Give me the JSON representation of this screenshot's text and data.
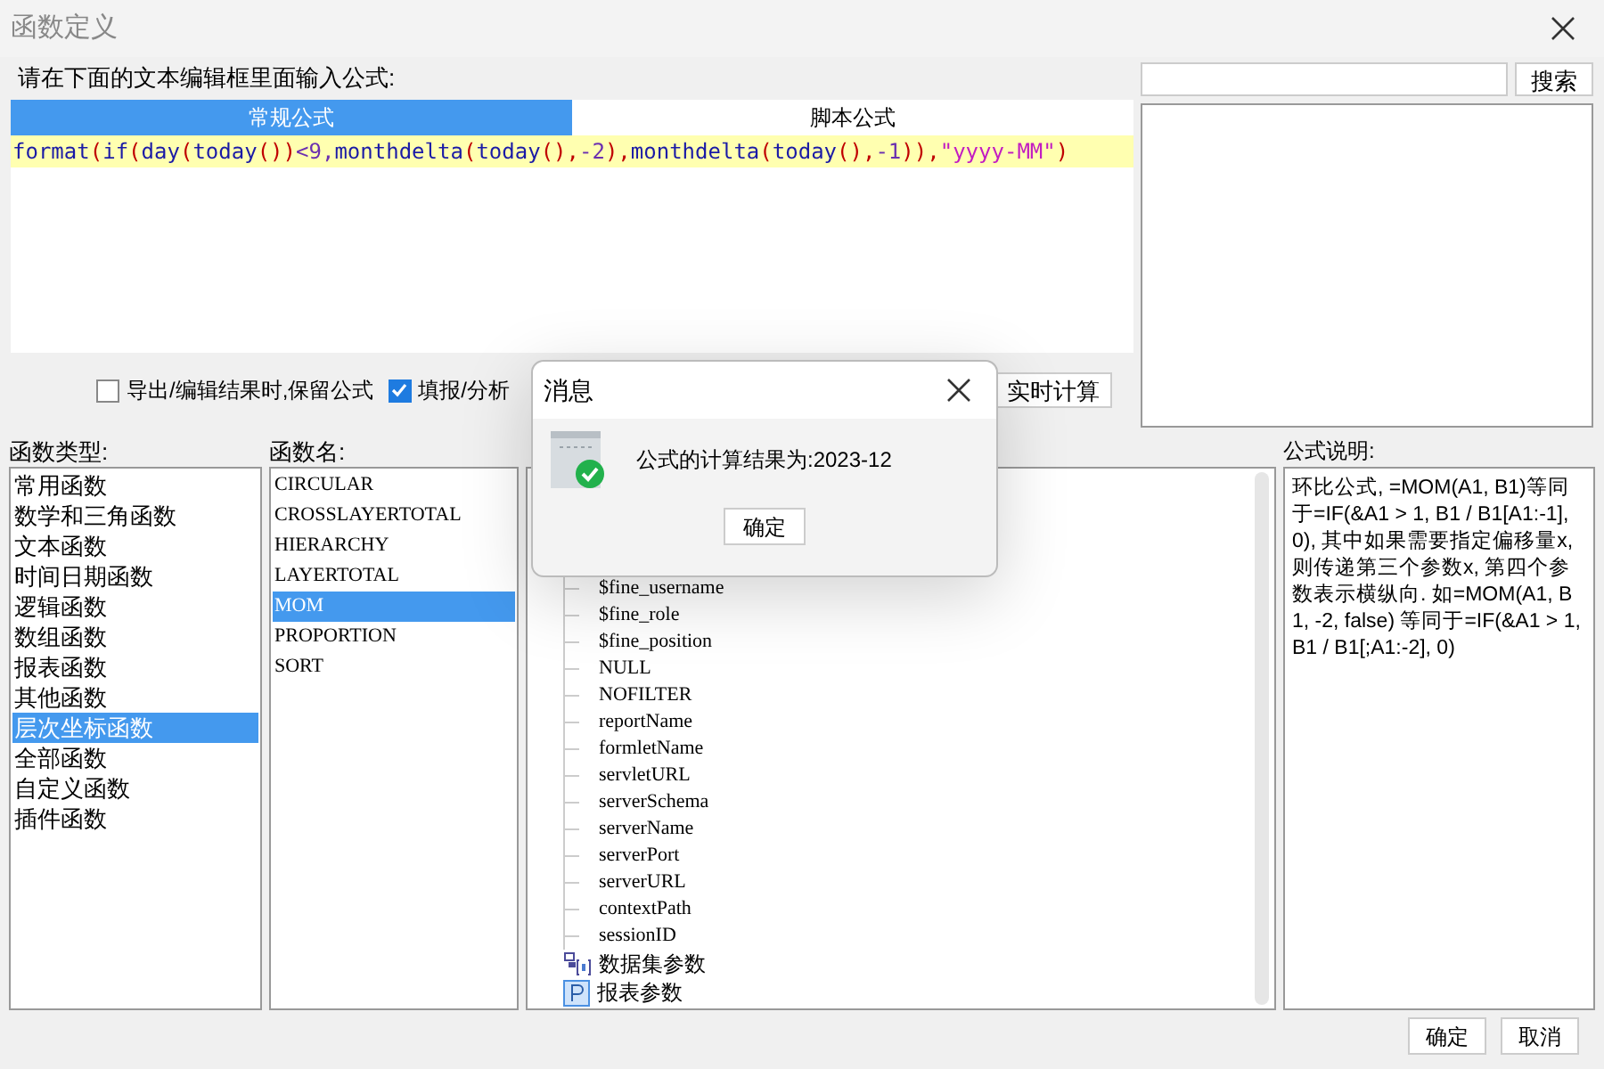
{
  "window": {
    "title": "函数定义"
  },
  "editor": {
    "prompt": "请在下面的文本编辑框里面输入公式:",
    "tabs": [
      {
        "label": "常规公式",
        "selected": true
      },
      {
        "label": "脚本公式",
        "selected": false
      }
    ],
    "formula": [
      {
        "text": "format",
        "kind": "func"
      },
      {
        "text": "(",
        "kind": "paren"
      },
      {
        "text": "if",
        "kind": "func"
      },
      {
        "text": "(",
        "kind": "paren"
      },
      {
        "text": "day",
        "kind": "func"
      },
      {
        "text": "(",
        "kind": "paren"
      },
      {
        "text": "today",
        "kind": "func"
      },
      {
        "text": "())",
        "kind": "paren"
      },
      {
        "text": "<9,",
        "kind": "num"
      },
      {
        "text": "monthdelta",
        "kind": "func"
      },
      {
        "text": "(",
        "kind": "paren"
      },
      {
        "text": "today",
        "kind": "func"
      },
      {
        "text": "(),",
        "kind": "paren"
      },
      {
        "text": "-2",
        "kind": "num"
      },
      {
        "text": "),",
        "kind": "paren"
      },
      {
        "text": "monthdelta",
        "kind": "func"
      },
      {
        "text": "(",
        "kind": "paren"
      },
      {
        "text": "today",
        "kind": "func"
      },
      {
        "text": "(),",
        "kind": "paren"
      },
      {
        "text": "-1",
        "kind": "num"
      },
      {
        "text": ")),",
        "kind": "paren"
      },
      {
        "text": "\"yyyy-MM\"",
        "kind": "string"
      },
      {
        "text": ")",
        "kind": "paren"
      }
    ]
  },
  "options": [
    {
      "label": "导出/编辑结果时,保留公式",
      "checked": false
    },
    {
      "label": "填报/分析",
      "checked": true
    }
  ],
  "realtime_button": "实时计算",
  "search": {
    "button": "搜索"
  },
  "function_types": {
    "label": "函数类型:",
    "items": [
      {
        "label": "常用函数",
        "selected": false
      },
      {
        "label": "数学和三角函数",
        "selected": false
      },
      {
        "label": "文本函数",
        "selected": false
      },
      {
        "label": "时间日期函数",
        "selected": false
      },
      {
        "label": "逻辑函数",
        "selected": false
      },
      {
        "label": "数组函数",
        "selected": false
      },
      {
        "label": "报表函数",
        "selected": false
      },
      {
        "label": "其他函数",
        "selected": false
      },
      {
        "label": "层次坐标函数",
        "selected": true
      },
      {
        "label": "全部函数",
        "selected": false
      },
      {
        "label": "自定义函数",
        "selected": false
      },
      {
        "label": "插件函数",
        "selected": false
      }
    ]
  },
  "function_names": {
    "label": "函数名:",
    "items": [
      {
        "label": "CIRCULAR",
        "selected": false
      },
      {
        "label": "CROSSLAYERTOTAL",
        "selected": false
      },
      {
        "label": "HIERARCHY",
        "selected": false
      },
      {
        "label": "LAYERTOTAL",
        "selected": false
      },
      {
        "label": "MOM",
        "selected": true
      },
      {
        "label": "PROPORTION",
        "selected": false
      },
      {
        "label": "SORT",
        "selected": false
      }
    ]
  },
  "variables": {
    "items": [
      {
        "label": "$fine_username"
      },
      {
        "label": "$fine_role"
      },
      {
        "label": "$fine_position"
      },
      {
        "label": "NULL"
      },
      {
        "label": "NOFILTER"
      },
      {
        "label": "reportName"
      },
      {
        "label": "formletName"
      },
      {
        "label": "servletURL"
      },
      {
        "label": "serverSchema"
      },
      {
        "label": "serverName"
      },
      {
        "label": "serverPort"
      },
      {
        "label": "serverURL"
      },
      {
        "label": "contextPath"
      },
      {
        "label": "sessionID"
      }
    ],
    "groups": [
      {
        "label": "数据集参数",
        "kind": "dataset"
      },
      {
        "label": "报表参数",
        "kind": "param"
      }
    ]
  },
  "description": {
    "label": "公式说明:",
    "text": "环比公式, =MOM(A1, B1)等同于=IF(&A1 > 1, B1 / B1[A1:-1],0), 其中如果需要指定偏移量x, 则传递第三个参数x, 第四个参数表示横纵向. 如=MOM(A1, B1, -2, false) 等同于=IF(&A1 > 1, B1 / B1[;A1:-2], 0)"
  },
  "buttons": [
    "确定",
    "取消"
  ],
  "message": {
    "title": "消息",
    "text": "公式的计算结果为:2023-12",
    "button": "确定"
  }
}
